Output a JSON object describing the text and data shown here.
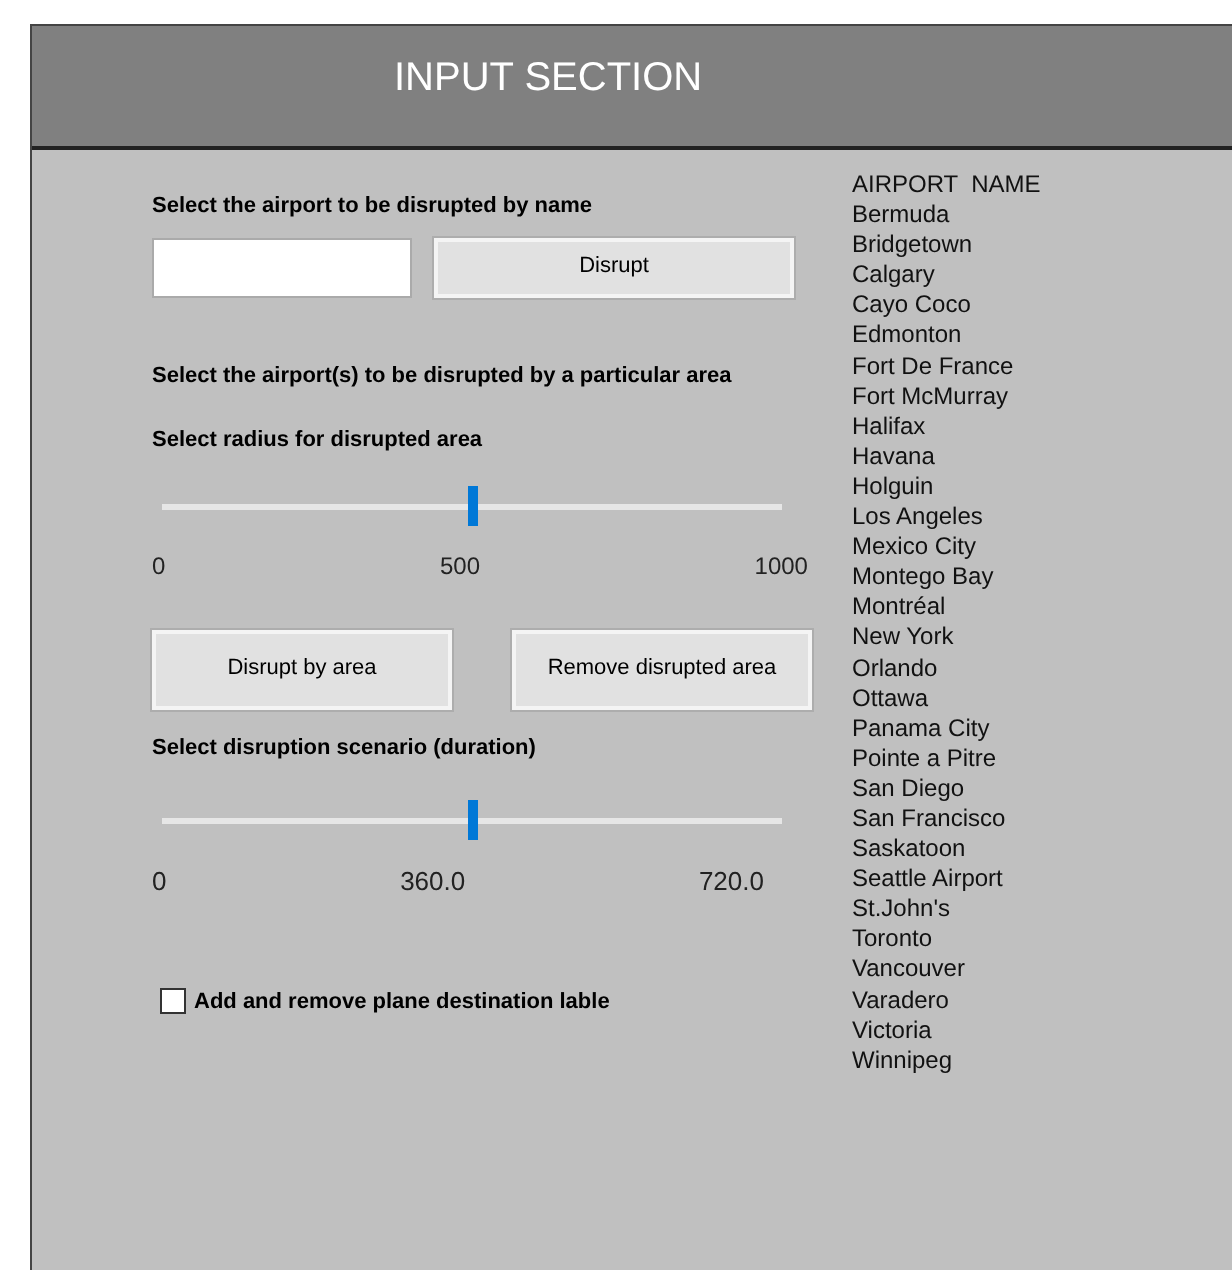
{
  "header": {
    "title": "INPUT SECTION"
  },
  "by_name": {
    "label": "Select the airport to be disrupted by name",
    "button": "Disrupt"
  },
  "by_area": {
    "label": "Select the airport(s) to be disrupted by a particular area",
    "radius_label": "Select radius for disrupted area",
    "radius_slider": {
      "level": 0.5,
      "ticks": [
        "0",
        "500",
        "1000"
      ]
    },
    "buttons": [
      "Disrupt by area",
      "Remove disrupted area"
    ]
  },
  "duration": {
    "label": "Select disruption scenario (duration)",
    "slider": {
      "level": 0.5,
      "ticks": [
        "0",
        "360.0",
        "720.0"
      ]
    }
  },
  "destination_label": {
    "label": "Add and remove plane destination lable",
    "checked": false
  },
  "airports": {
    "heading": "AIRPORT  NAME",
    "items": [
      "Bermuda",
      "Bridgetown",
      "Calgary",
      "Cayo Coco",
      "Edmonton",
      "Fort De France",
      "Fort McMurray",
      "Halifax",
      "Havana",
      "Holguin",
      "Los Angeles",
      "Mexico City",
      "Montego Bay",
      "Montréal",
      "New York",
      "Orlando",
      "Ottawa",
      "Panama City",
      "Pointe a Pitre",
      "San Diego",
      "San Francisco",
      "Saskatoon",
      "Seattle Airport",
      "St.John's",
      "Toronto",
      "Vancouver",
      "Varadero",
      "Victoria",
      "Winnipeg"
    ]
  }
}
